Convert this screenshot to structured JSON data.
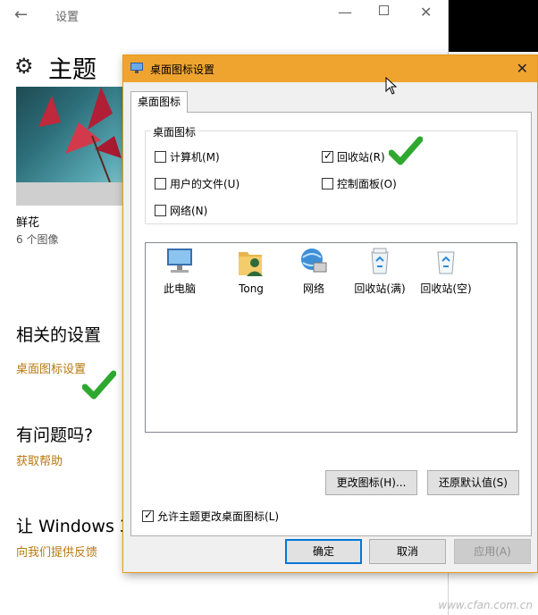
{
  "settings": {
    "title": "设置",
    "heading": "主题",
    "theme_name": "鲜花",
    "theme_count": "6 个图像",
    "related_title": "相关的设置",
    "related_link": "桌面图标设置",
    "question_title": "有问题吗?",
    "help_link": "获取帮助",
    "windows_title": "让 Windows 3",
    "feedback_link": "向我们提供反馈"
  },
  "dialog": {
    "title": "桌面图标设置",
    "tab": "桌面图标",
    "group_label": "桌面图标",
    "checkboxes": [
      {
        "label": "计算机(M)",
        "checked": false
      },
      {
        "label": "回收站(R)",
        "checked": true
      },
      {
        "label": "用户的文件(U)",
        "checked": false
      },
      {
        "label": "控制面板(O)",
        "checked": false
      },
      {
        "label": "网络(N)",
        "checked": false
      }
    ],
    "icons": [
      {
        "label": "此电脑",
        "icon": "computer-icon"
      },
      {
        "label": "Tong",
        "icon": "user-folder-icon"
      },
      {
        "label": "网络",
        "icon": "network-icon"
      },
      {
        "label": "回收站(满)",
        "icon": "recycle-bin-full-icon"
      },
      {
        "label": "回收站(空)",
        "icon": "recycle-bin-empty-icon"
      }
    ],
    "change_icon_btn": "更改图标(H)...",
    "restore_btn": "还原默认值(S)",
    "allow_theme": {
      "label": "允许主题更改桌面图标(L)",
      "checked": true
    },
    "ok_btn": "确定",
    "cancel_btn": "取消",
    "apply_btn": "应用(A)"
  },
  "watermark": "www.cfan.com.cn",
  "colors": {
    "accent_title": "#f0a430",
    "link": "#b7790f",
    "check_annotation": "#2fa82f",
    "primary_border": "#0078d7"
  }
}
